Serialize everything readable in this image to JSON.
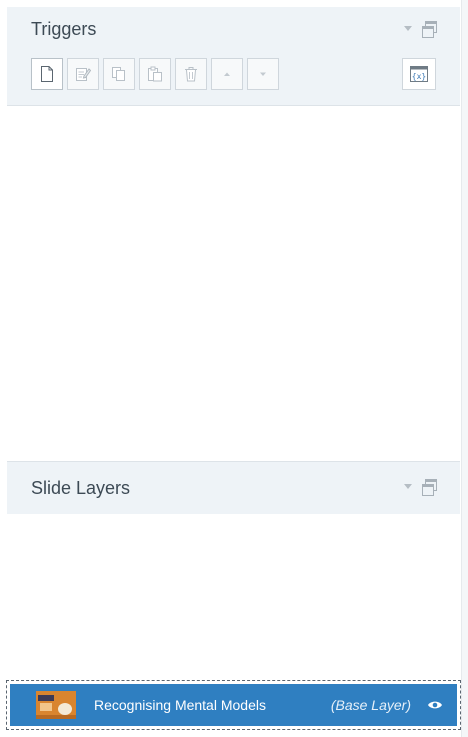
{
  "triggers": {
    "title": "Triggers",
    "toolbar": [
      {
        "icon": "new-trigger-icon",
        "enabled": true
      },
      {
        "icon": "edit-trigger-icon",
        "enabled": false
      },
      {
        "icon": "copy-icon",
        "enabled": false
      },
      {
        "icon": "paste-icon",
        "enabled": false
      },
      {
        "icon": "delete-icon",
        "enabled": false
      },
      {
        "icon": "move-up-icon",
        "enabled": false
      },
      {
        "icon": "move-down-icon",
        "enabled": false
      }
    ],
    "variables_icon": "variables-icon"
  },
  "slide_layers": {
    "title": "Slide Layers",
    "base_layer": {
      "name": "Recognising Mental Models",
      "tag": "(Base Layer)"
    }
  },
  "colors": {
    "header_bg": "#eef3f7",
    "selected_row": "#2f7fc1",
    "title_text": "#3d4a55"
  }
}
